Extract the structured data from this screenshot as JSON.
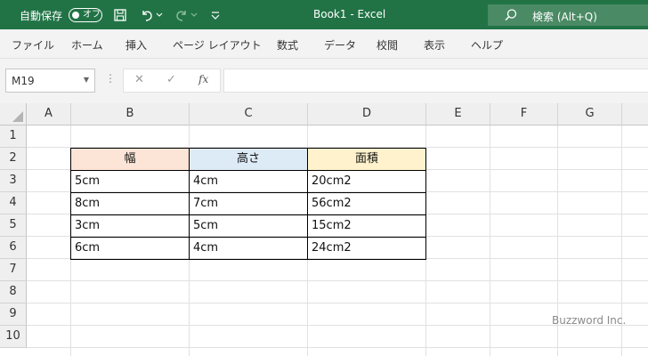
{
  "titlebar": {
    "autosave_label": "自動保存",
    "autosave_state": "オフ",
    "doc_title": "Book1  -  Excel",
    "search_label": "検索 (Alt+Q)",
    "accent_color": "#217346"
  },
  "menu": [
    "ファイル",
    "ホーム",
    "挿入",
    "ページ レイアウト",
    "数式",
    "データ",
    "校閲",
    "表示",
    "ヘルプ"
  ],
  "formula_bar": {
    "name_box": "M19",
    "cancel_icon": "✕",
    "enter_icon": "✓",
    "function_icon": "fx",
    "formula": ""
  },
  "grid": {
    "columns": [
      "A",
      "B",
      "C",
      "D",
      "E",
      "F",
      "G"
    ],
    "rows": [
      "1",
      "2",
      "3",
      "4",
      "5",
      "6",
      "7",
      "8",
      "9",
      "10"
    ]
  },
  "table": {
    "headers": [
      "幅",
      "高さ",
      "面積"
    ],
    "header_colors": [
      "#fce4d6",
      "#ddebf7",
      "#fff2cc"
    ],
    "rows": [
      [
        "5cm",
        "4cm",
        "20cm2"
      ],
      [
        "8cm",
        "7cm",
        "56cm2"
      ],
      [
        "3cm",
        "5cm",
        "15cm2"
      ],
      [
        "6cm",
        "4cm",
        "24cm2"
      ]
    ]
  },
  "watermark": "Buzzword Inc."
}
